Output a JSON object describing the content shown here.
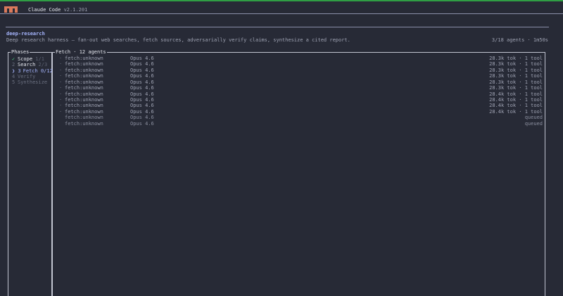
{
  "app": {
    "name": "Claude Code",
    "version": "v2.1.201"
  },
  "workflow": {
    "name": "deep-research",
    "description": "Deep research harness — fan-out web searches, fetch sources, adversarially verify claims, synthesize a cited report.",
    "status": "3/18 agents · 1m50s"
  },
  "phases": {
    "title": "Phases",
    "items": [
      {
        "marker": "✓",
        "label": "Scope",
        "count": "1/1",
        "state": "done"
      },
      {
        "marker": "2",
        "label": "Search",
        "count": "2/3",
        "state": "next"
      },
      {
        "marker": "❯ 3",
        "label": "Fetch 0/12",
        "count": "",
        "state": "active"
      },
      {
        "marker": "4",
        "label": "Verify",
        "count": "",
        "state": "pending"
      },
      {
        "marker": "5",
        "label": "Synthesize",
        "count": "",
        "state": "pending"
      }
    ]
  },
  "agents": {
    "title": "Fetch · 12 agents",
    "rows": [
      {
        "dot": "·",
        "name": "fetch:unknown",
        "model": "Opus 4.6",
        "stat": "28.3k tok · 1 tool"
      },
      {
        "dot": "·",
        "name": "fetch:unknown",
        "model": "Opus 4.6",
        "stat": "28.3k tok · 1 tool"
      },
      {
        "dot": "·",
        "name": "fetch:unknown",
        "model": "Opus 4.6",
        "stat": "28.3k tok · 1 tool"
      },
      {
        "dot": "·",
        "name": "fetch:unknown",
        "model": "Opus 4.6",
        "stat": "28.3k tok · 1 tool"
      },
      {
        "dot": "·",
        "name": "fetch:unknown",
        "model": "Opus 4.6",
        "stat": "28.3k tok · 1 tool"
      },
      {
        "dot": "·",
        "name": "fetch:unknown",
        "model": "Opus 4.6",
        "stat": "28.3k tok · 1 tool"
      },
      {
        "dot": "·",
        "name": "fetch:unknown",
        "model": "Opus 4.6",
        "stat": "28.4k tok · 1 tool"
      },
      {
        "dot": "·",
        "name": "fetch:unknown",
        "model": "Opus 4.6",
        "stat": "28.4k tok · 1 tool"
      },
      {
        "dot": "·",
        "name": "fetch:unknown",
        "model": "Opus 4.6",
        "stat": "28.4k tok · 1 tool"
      },
      {
        "dot": "·",
        "name": "fetch:unknown",
        "model": "Opus 4.6",
        "stat": "28.4k tok · 1 tool"
      },
      {
        "dot": "",
        "name": "fetch:unknown",
        "model": "Opus 4.6",
        "stat": "queued"
      },
      {
        "dot": "",
        "name": "fetch:unknown",
        "model": "Opus 4.6",
        "stat": "queued"
      }
    ]
  },
  "colors": {
    "background": "#272a36",
    "accent": "#a5b4fc",
    "logo": "#d97a5c",
    "top_line": "#2f9e44",
    "done": "#4ade80"
  }
}
